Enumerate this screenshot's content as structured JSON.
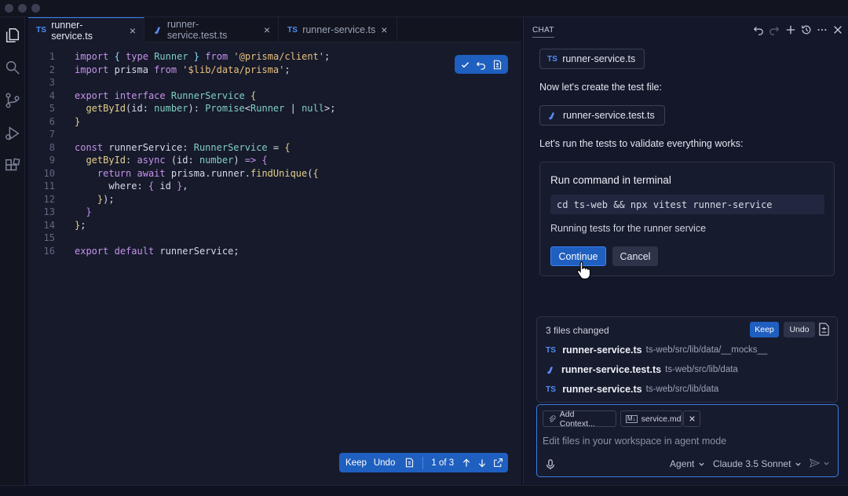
{
  "window": {
    "title": ""
  },
  "tabs": [
    {
      "label": "runner-service.ts",
      "badge": "TS",
      "active": true
    },
    {
      "label": "runner-service.test.ts",
      "badge": "flask-icon",
      "active": false
    },
    {
      "label": "runner-service.ts",
      "badge": "TS",
      "active": false
    }
  ],
  "editor": {
    "line_numbers": [
      "1",
      "2",
      "3",
      "4",
      "5",
      "6",
      "7",
      "8",
      "9",
      "10",
      "11",
      "12",
      "13",
      "14",
      "15",
      "16"
    ],
    "keep_bar": {
      "keep": "Keep",
      "undo": "Undo",
      "counter": "1 of 3"
    }
  },
  "chat": {
    "title": "CHAT",
    "file_chip_1": "runner-service.ts",
    "msg_1": "Now let's create the test file:",
    "file_chip_2": "runner-service.test.ts",
    "msg_2": "Let's run the tests to validate everything works:",
    "command": {
      "title": "Run command in terminal",
      "code": "cd ts-web && npx vitest runner-service",
      "description": "Running tests for the runner service",
      "continue": "Continue",
      "cancel": "Cancel"
    },
    "changes": {
      "title": "3 files changed",
      "keep": "Keep",
      "undo": "Undo",
      "files": [
        {
          "name": "runner-service.ts",
          "path": "ts-web/src/lib/data/__mocks__",
          "badge": "TS"
        },
        {
          "name": "runner-service.test.ts",
          "path": "ts-web/src/lib/data",
          "badge": "flask-icon"
        },
        {
          "name": "runner-service.ts",
          "path": "ts-web/src/lib/data",
          "badge": "TS"
        }
      ]
    },
    "input": {
      "add_context": "Add Context...",
      "context_file": "service.md",
      "placeholder": "Edit files in your workspace in agent mode",
      "mode": "Agent",
      "model": "Claude 3.5 Sonnet"
    }
  },
  "colors": {
    "accent": "#1f5fbf",
    "ts_badge": "#4f8ff7",
    "background": "#161a2b"
  }
}
